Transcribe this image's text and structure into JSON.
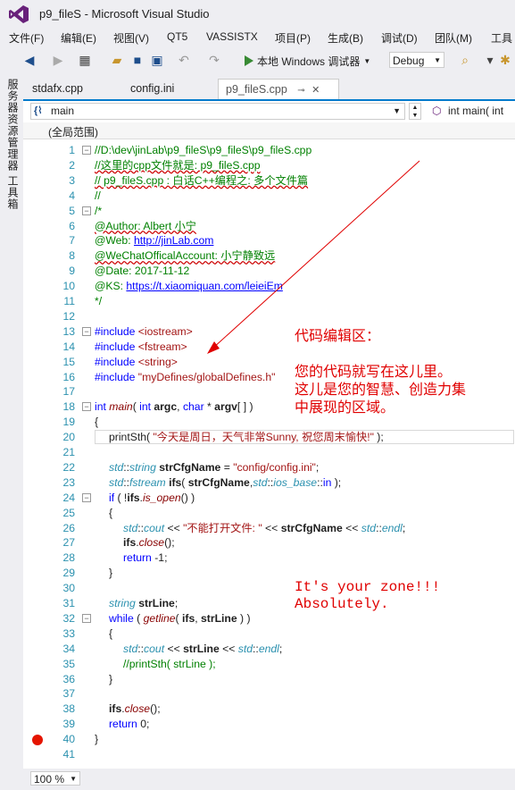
{
  "window": {
    "title": "p9_fileS - Microsoft Visual Studio"
  },
  "menu": [
    "文件(F)",
    "编辑(E)",
    "视图(V)",
    "QT5",
    "VASSISTX",
    "项目(P)",
    "生成(B)",
    "调试(D)",
    "团队(M)",
    "工具"
  ],
  "toolbar": {
    "run_label": "本地 Windows 调试器",
    "config": "Debug"
  },
  "left_rail": [
    "服务器资源管理器",
    "工具箱"
  ],
  "tabs": [
    {
      "label": "stdafx.cpp"
    },
    {
      "label": "config.ini"
    },
    {
      "label": "p9_fileS.cpp"
    }
  ],
  "navbar": {
    "scope": "main",
    "member": "int main( int"
  },
  "global_scope": "(全局范围)",
  "code": {
    "l1": "//D:\\dev\\jinLab\\p9_fileS\\p9_fileS\\p9_fileS.cpp",
    "l2": "//这里的cpp文件就是: p9_fileS.cpp",
    "l3": "// p9_fileS.cpp : 白话C++编程之: 多个文件篇",
    "l4": "//",
    "l5": "/*",
    "l6": "@Author: Albert 小宁",
    "l7a": "@Web: ",
    "l7b": "http://jinLab.com",
    "l8": "@WeChatOfficalAccount: 小宁静致远",
    "l9": "@Date: 2017-11-12",
    "l10a": "@KS: ",
    "l10b": "https://t.xiaomiquan.com/leieiEm",
    "l11": "*/",
    "l13a": "#include ",
    "l13b": "<iostream>",
    "l14b": "<fstream>",
    "l15b": "<string>",
    "l16b": "\"myDefines/globalDefines.h\"",
    "l18": [
      "int",
      " main",
      "( ",
      "int",
      " argc",
      ", ",
      "char",
      " * ",
      "argv",
      "[ ] )"
    ],
    "l19": "{",
    "l20a": "printSth( ",
    "l20b": "\"今天是周日，天气非常Sunny, 祝您周末愉快!\"",
    "l20c": " );",
    "l22": [
      "std",
      "::",
      "string",
      " strCfgName",
      " = ",
      "\"config/config.ini\"",
      ";"
    ],
    "l23": [
      "std",
      "::",
      "fstream",
      " ifs",
      "( ",
      "strCfgName",
      ",",
      "std",
      "::",
      "ios_base",
      "::",
      "in",
      " );"
    ],
    "l24": [
      "if",
      " ( !",
      "ifs",
      ".",
      "is_open",
      "() )"
    ],
    "l25": "{",
    "l26": [
      "std",
      "::",
      "cout",
      " << ",
      "\"不能打开文件: \"",
      " << ",
      "strCfgName",
      " << ",
      "std",
      "::",
      "endl",
      ";"
    ],
    "l27": [
      "ifs",
      ".",
      "close",
      "();"
    ],
    "l28": [
      "return",
      " -1;"
    ],
    "l29": "}",
    "l31": [
      "string",
      " strLine",
      ";"
    ],
    "l32": [
      "while",
      " ( ",
      "getline",
      "( ",
      "ifs",
      ", ",
      "strLine",
      " ) )"
    ],
    "l33": "{",
    "l34": [
      "std",
      "::",
      "cout",
      " << ",
      "strLine",
      " << ",
      "std",
      "::",
      "endl",
      ";"
    ],
    "l35": "//printSth( strLine );",
    "l36": "}",
    "l38": [
      "ifs",
      ".",
      "close",
      "();"
    ],
    "l39": [
      "return",
      " 0;"
    ],
    "l40": "}"
  },
  "line_numbers": [
    "1",
    "2",
    "3",
    "4",
    "5",
    "6",
    "7",
    "8",
    "9",
    "10",
    "11",
    "12",
    "13",
    "14",
    "15",
    "16",
    "17",
    "18",
    "19",
    "20",
    "21",
    "22",
    "23",
    "24",
    "25",
    "26",
    "27",
    "28",
    "29",
    "30",
    "31",
    "32",
    "33",
    "34",
    "35",
    "36",
    "37",
    "38",
    "39",
    "40",
    "41"
  ],
  "annotations": {
    "zone_cn": [
      "代码编辑区：",
      "",
      "您的代码就写在这儿里。",
      "这儿是您的智慧、创造力集",
      "中展现的区域。"
    ],
    "zone_en": [
      "It's your zone!!!",
      "Absolutely."
    ]
  },
  "status": {
    "zoom": "100 %"
  },
  "colors": {
    "accent": "#007acc",
    "annotation": "#e00000",
    "breakpoint": "#e51400"
  }
}
